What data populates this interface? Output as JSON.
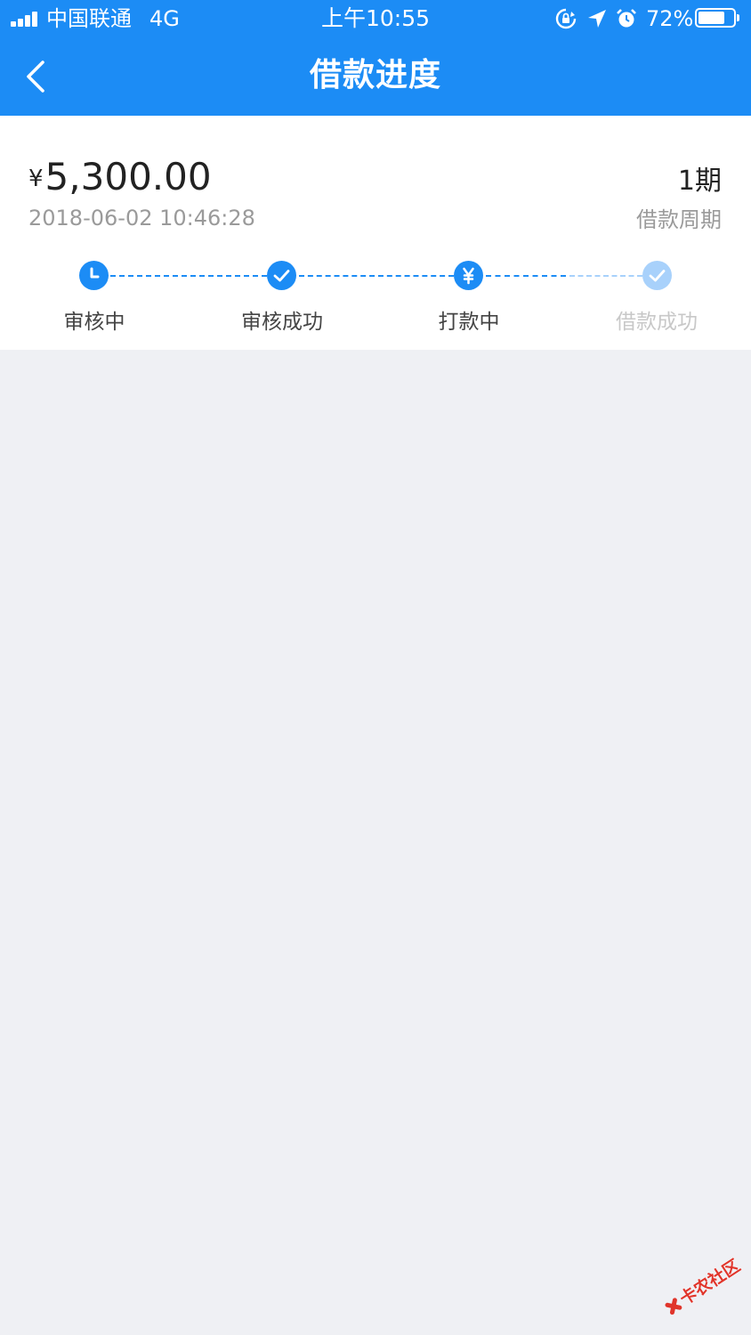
{
  "status_bar": {
    "carrier": "中国联通",
    "network": "4G",
    "time": "上午10:55",
    "battery_pct": "72%",
    "battery_level": 0.72,
    "icons": [
      "signal-icon",
      "orientation-lock-icon",
      "location-icon",
      "alarm-icon",
      "battery-icon"
    ]
  },
  "nav": {
    "title": "借款进度",
    "back_icon": "chevron-left-icon"
  },
  "loan": {
    "currency": "¥",
    "amount": "5,300.00",
    "datetime": "2018-06-02 10:46:28",
    "period": "1期",
    "period_label": "借款周期"
  },
  "progress": {
    "current_step": 3,
    "steps": [
      {
        "label": "审核中",
        "icon": "clock-icon",
        "done": true
      },
      {
        "label": "审核成功",
        "icon": "check-icon",
        "done": true
      },
      {
        "label": "打款中",
        "icon": "yen-icon",
        "done": true
      },
      {
        "label": "借款成功",
        "icon": "check-icon",
        "done": false
      }
    ]
  },
  "watermark": {
    "text": "卡农社区"
  },
  "colors": {
    "primary": "#1c8cf5",
    "primary_faded": "#a8d1fb",
    "background": "#eff0f4",
    "card": "#ffffff",
    "text_primary": "#222222",
    "text_secondary": "#9a9a9a",
    "text_disabled": "#c8c8c8",
    "watermark": "#e0352b"
  }
}
